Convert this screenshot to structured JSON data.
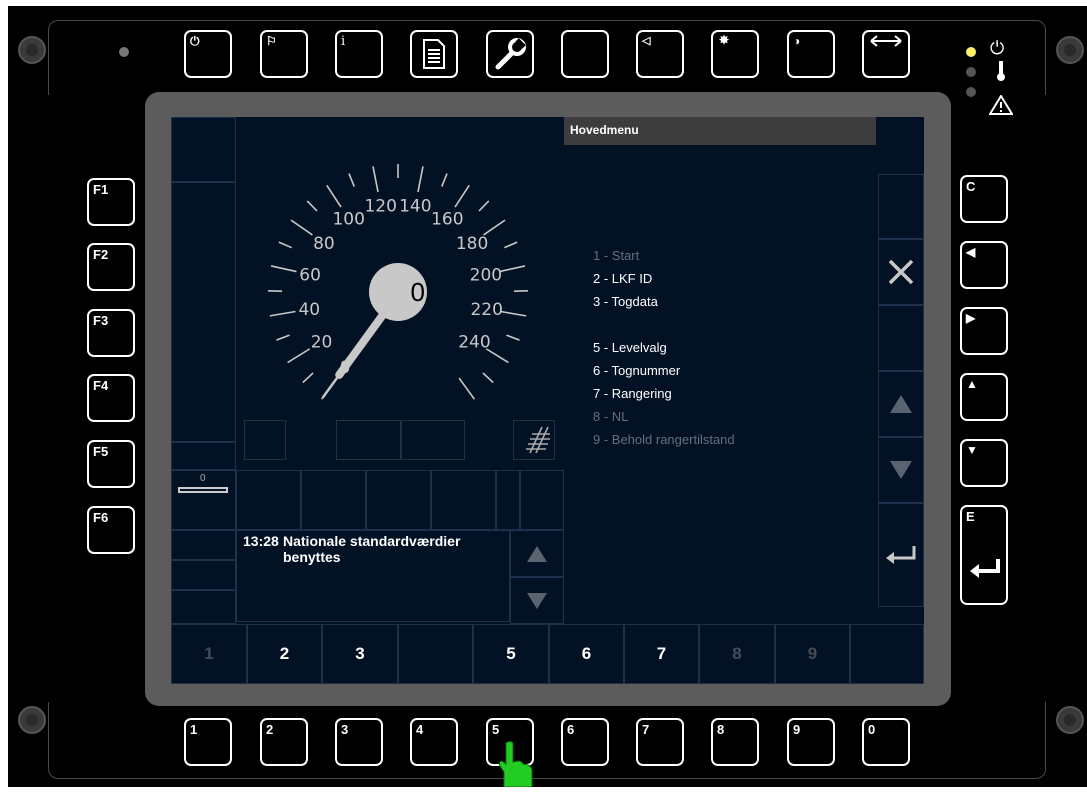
{
  "side_keys": [
    {
      "id": "f1",
      "label": "F1"
    },
    {
      "id": "f2",
      "label": "F2"
    },
    {
      "id": "f3",
      "label": "F3"
    },
    {
      "id": "f4",
      "label": "F4"
    },
    {
      "id": "f5",
      "label": "F5"
    },
    {
      "id": "f6",
      "label": "F6"
    }
  ],
  "right_keys": {
    "c": "C",
    "e": "E"
  },
  "top_keys": {
    "info": "i"
  },
  "bottom_keys": [
    "1",
    "2",
    "3",
    "4",
    "5",
    "6",
    "7",
    "8",
    "9",
    "0"
  ],
  "speedometer": {
    "speed": "0",
    "scale": [
      "0",
      "20",
      "40",
      "60",
      "80",
      "100",
      "120",
      "140",
      "160",
      "180",
      "200",
      "220",
      "240"
    ]
  },
  "distance_bar": {
    "value": "0"
  },
  "menu": {
    "title": "Hovedmenu",
    "items": [
      {
        "num": "1",
        "label": "Start",
        "enabled": false
      },
      {
        "num": "2",
        "label": "LKF ID",
        "enabled": true
      },
      {
        "num": "3",
        "label": "Togdata",
        "enabled": true
      },
      {
        "num": "5",
        "label": "Levelvalg",
        "enabled": true
      },
      {
        "num": "6",
        "label": "Tognummer",
        "enabled": true
      },
      {
        "num": "7",
        "label": "Rangering",
        "enabled": true
      },
      {
        "num": "8",
        "label": "NL",
        "enabled": false
      },
      {
        "num": "9",
        "label": "Behold rangertilstand",
        "enabled": false
      }
    ]
  },
  "message": {
    "time": "13:28",
    "text": "Nationale standardværdier benyttes"
  },
  "softkeys": [
    {
      "label": "1",
      "enabled": false
    },
    {
      "label": "2",
      "enabled": true
    },
    {
      "label": "3",
      "enabled": true
    },
    {
      "label": "",
      "enabled": false
    },
    {
      "label": "5",
      "enabled": true
    },
    {
      "label": "6",
      "enabled": true
    },
    {
      "label": "7",
      "enabled": true
    },
    {
      "label": "8",
      "enabled": false
    },
    {
      "label": "9",
      "enabled": false
    },
    {
      "label": "",
      "enabled": false
    }
  ],
  "colors": {
    "screen": "#031124",
    "frame": "#5c5c5c",
    "led_on": "#ffee66",
    "cursor": "#22cc22"
  }
}
